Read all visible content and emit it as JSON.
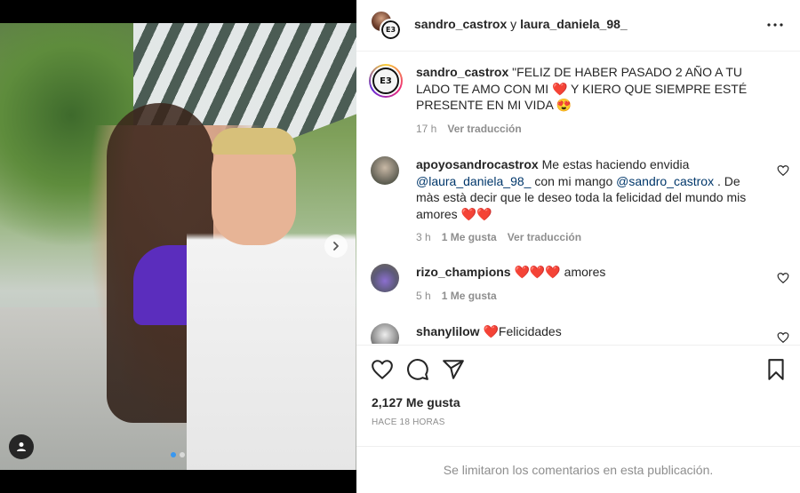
{
  "post": {
    "carousel_total": 2,
    "carousel_active": 1
  },
  "header": {
    "user1": "sandro_castrox",
    "joiner": "y",
    "user2": "laura_daniela_98_"
  },
  "caption": {
    "user": "sandro_castrox",
    "text": "\"FELIZ DE HABER PASADO 2 AÑO A TU LADO TE AMO CON MI ❤️ Y KIERO QUE SIEMPRE ESTÉ PRESENTE EN MI VIDA 😍",
    "time": "17 h",
    "translate": "Ver traducción"
  },
  "comments": [
    {
      "user": "apoyosandrocastrox",
      "text_a": "Me estas haciendo envidia",
      "mention_a": "@laura_daniela_98_",
      "text_b": "con mi mango",
      "mention_b": "@sandro_castrox",
      "text_c": ". De màs està decir que le deseo toda la felicidad del mundo mis amores ❤️❤️",
      "time": "3 h",
      "likes": "1 Me gusta",
      "translate": "Ver traducción"
    },
    {
      "user": "rizo_champions",
      "text": "❤️❤️❤️ amores",
      "time": "5 h",
      "likes": "1 Me gusta"
    },
    {
      "user": "shanylilow",
      "text": "❤️Felicidades"
    }
  ],
  "actions": {
    "likes": "2,127 Me gusta",
    "time_ago": "HACE 18 HORAS"
  },
  "footer": {
    "limited": "Se limitaron los comentarios en esta publicación."
  },
  "badge_text": "E3"
}
